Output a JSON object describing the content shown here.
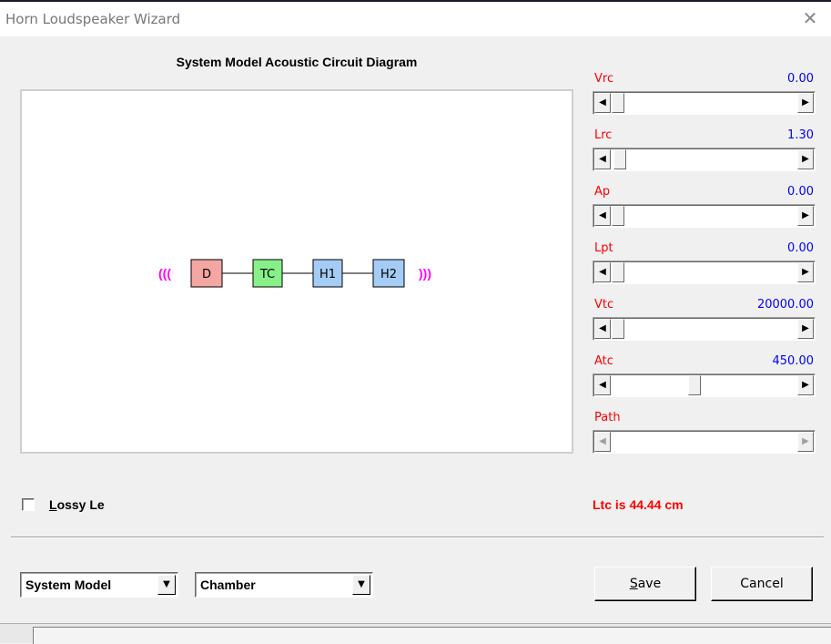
{
  "window": {
    "title": "Horn Loudspeaker Wizard",
    "close_glyph": "✕"
  },
  "diagram": {
    "title": "System Model Acoustic Circuit Diagram",
    "left_wave": "(((",
    "right_wave": ")))",
    "blocks": [
      {
        "label": "D",
        "color": "#f4a6a2"
      },
      {
        "label": "TC",
        "color": "#88f088"
      },
      {
        "label": "H1",
        "color": "#a4ccf4"
      },
      {
        "label": "H2",
        "color": "#a4ccf4"
      }
    ],
    "wave_color": "#ff00ff"
  },
  "sliders": [
    {
      "label": "Vrc",
      "value": "0.00"
    },
    {
      "label": "Lrc",
      "value": "1.30"
    },
    {
      "label": "Ap",
      "value": "0.00"
    },
    {
      "label": "Lpt",
      "value": "0.00"
    },
    {
      "label": "Vtc",
      "value": "20000.00"
    },
    {
      "label": "Atc",
      "value": "450.00"
    },
    {
      "label": "Path",
      "value": ""
    }
  ],
  "lossy": {
    "label": "Lossy Le",
    "checked": false
  },
  "status": {
    "ltc": "Ltc is 44.44 cm"
  },
  "combos": {
    "model": "System Model",
    "chamber": "Chamber"
  },
  "buttons": {
    "save": "Save",
    "cancel": "Cancel"
  }
}
